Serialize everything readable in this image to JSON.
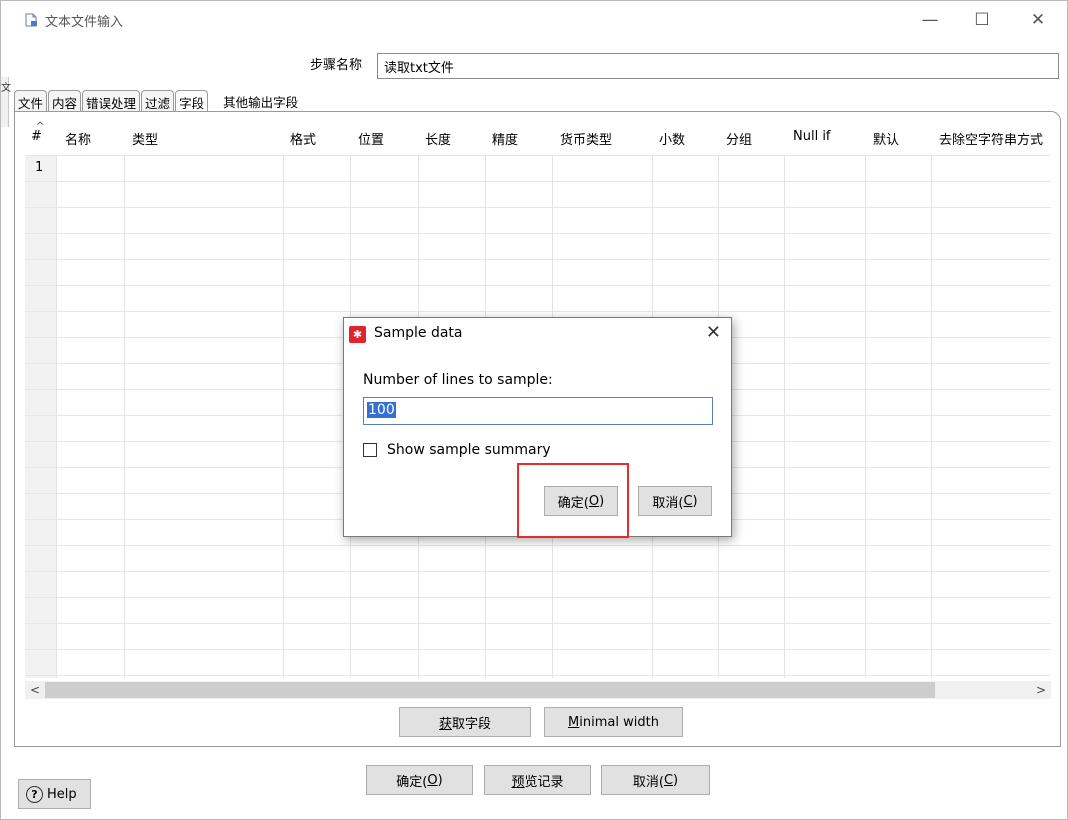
{
  "window": {
    "title": "文本文件输入",
    "minimize_glyph": "—",
    "maximize_glyph": "☐",
    "close_glyph": "✕"
  },
  "left_strip_glyph": "文",
  "step": {
    "label": "步骤名称",
    "value": "读取txt文件"
  },
  "tabs": [
    {
      "label": "文件"
    },
    {
      "label": "内容"
    },
    {
      "label": "错误处理"
    },
    {
      "label": "过滤"
    },
    {
      "label": "字段",
      "active": true
    },
    {
      "label": "其他输出字段"
    }
  ],
  "grid": {
    "columns": [
      "#",
      "名称",
      "类型",
      "格式",
      "位置",
      "长度",
      "精度",
      "货币类型",
      "小数",
      "分组",
      "Null if",
      "默认",
      "去除空字符串方式"
    ],
    "rows": [
      "1"
    ]
  },
  "buttons": {
    "get_fields_prefix": "",
    "get_fields_mnemonic": "获",
    "get_fields_rest": "取字段",
    "minimal_width_mnemonic": "M",
    "minimal_width_rest": "inimal width",
    "ok_text": "确定(",
    "ok_mnemonic": "O",
    "ok_close": ")",
    "preview_mnemonic": "预",
    "preview_rest": "览记录",
    "cancel_text": "取消(",
    "cancel_mnemonic": "C",
    "cancel_close": ")",
    "help": "Help"
  },
  "dialog": {
    "title": "Sample data",
    "close_glyph": "✕",
    "lines_label": "Number of lines to sample:",
    "lines_value": "100",
    "summary_label": "Show sample summary",
    "summary_checked": false,
    "ok_text": "确定(",
    "ok_mnemonic": "O",
    "ok_close": ")",
    "cancel_text": "取消(",
    "cancel_mnemonic": "C",
    "cancel_close": ")"
  },
  "colors": {
    "highlight": "#e62b2b",
    "dialog_icon": "#e0242b",
    "selection": "#3470d1"
  }
}
